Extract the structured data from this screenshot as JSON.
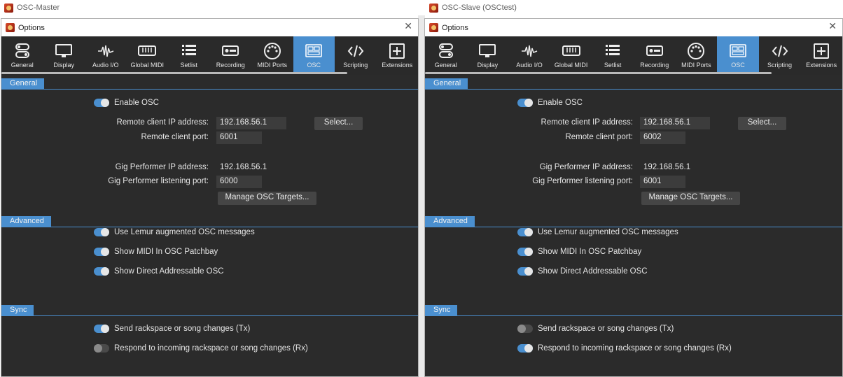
{
  "windows": [
    {
      "app_title": "OSC-Master",
      "dialog_title": "Options",
      "close_glyph": "✕",
      "tabs": [
        {
          "label": "General",
          "icon": "general-icon"
        },
        {
          "label": "Display",
          "icon": "display-icon"
        },
        {
          "label": "Audio I/O",
          "icon": "audio-waveform-icon"
        },
        {
          "label": "Global MIDI",
          "icon": "midi-keyboard-icon"
        },
        {
          "label": "Setlist",
          "icon": "setlist-icon"
        },
        {
          "label": "Recording",
          "icon": "record-icon"
        },
        {
          "label": "MIDI Ports",
          "icon": "midi-port-icon"
        },
        {
          "label": "OSC",
          "icon": "osc-icon",
          "active": true
        },
        {
          "label": "Scripting",
          "icon": "code-icon"
        },
        {
          "label": "Extensions",
          "icon": "plus-box-icon"
        }
      ],
      "sections": {
        "general": "General",
        "advanced": "Advanced",
        "sync": "Sync"
      },
      "enable_osc": {
        "label": "Enable OSC",
        "on": true
      },
      "remote_ip": {
        "label": "Remote client IP address:",
        "value": "192.168.56.1"
      },
      "select_button": "Select...",
      "remote_port": {
        "label": "Remote client port:",
        "value": "6001"
      },
      "gp_ip": {
        "label": "Gig Performer IP address:",
        "value": "192.168.56.1"
      },
      "gp_port": {
        "label": "Gig Performer listening port:",
        "value": "6000"
      },
      "manage_button": "Manage OSC Targets...",
      "advanced_options": [
        {
          "label": "Use Lemur augmented OSC messages",
          "on": true
        },
        {
          "label": "Show MIDI In OSC Patchbay",
          "on": true
        },
        {
          "label": "Show Direct Addressable OSC",
          "on": true
        }
      ],
      "sync_options": [
        {
          "label": "Send rackspace or song changes (Tx)",
          "on": true
        },
        {
          "label": "Respond to incoming rackspace or song changes (Rx)",
          "on": false
        }
      ]
    },
    {
      "app_title": "OSC-Slave (OSCtest)",
      "dialog_title": "Options",
      "close_glyph": "✕",
      "tabs": [
        {
          "label": "General",
          "icon": "general-icon"
        },
        {
          "label": "Display",
          "icon": "display-icon"
        },
        {
          "label": "Audio I/O",
          "icon": "audio-waveform-icon"
        },
        {
          "label": "Global MIDI",
          "icon": "midi-keyboard-icon"
        },
        {
          "label": "Setlist",
          "icon": "setlist-icon"
        },
        {
          "label": "Recording",
          "icon": "record-icon"
        },
        {
          "label": "MIDI Ports",
          "icon": "midi-port-icon"
        },
        {
          "label": "OSC",
          "icon": "osc-icon",
          "active": true
        },
        {
          "label": "Scripting",
          "icon": "code-icon"
        },
        {
          "label": "Extensions",
          "icon": "plus-box-icon"
        }
      ],
      "sections": {
        "general": "General",
        "advanced": "Advanced",
        "sync": "Sync"
      },
      "enable_osc": {
        "label": "Enable OSC",
        "on": true
      },
      "remote_ip": {
        "label": "Remote client IP address:",
        "value": "192.168.56.1"
      },
      "select_button": "Select...",
      "remote_port": {
        "label": "Remote client port:",
        "value": "6002"
      },
      "gp_ip": {
        "label": "Gig Performer IP address:",
        "value": "192.168.56.1"
      },
      "gp_port": {
        "label": "Gig Performer listening port:",
        "value": "6001"
      },
      "manage_button": "Manage OSC Targets...",
      "advanced_options": [
        {
          "label": "Use Lemur augmented OSC messages",
          "on": true
        },
        {
          "label": "Show MIDI In OSC Patchbay",
          "on": true
        },
        {
          "label": "Show Direct Addressable OSC",
          "on": true
        }
      ],
      "sync_options": [
        {
          "label": "Send rackspace or song changes (Tx)",
          "on": false
        },
        {
          "label": "Respond to incoming rackspace or song changes (Rx)",
          "on": true
        }
      ]
    }
  ],
  "colors": {
    "accent": "#4a8fcf",
    "panel": "#2b2b2b",
    "field": "#3c3c3c",
    "text": "#e4e4e4"
  }
}
